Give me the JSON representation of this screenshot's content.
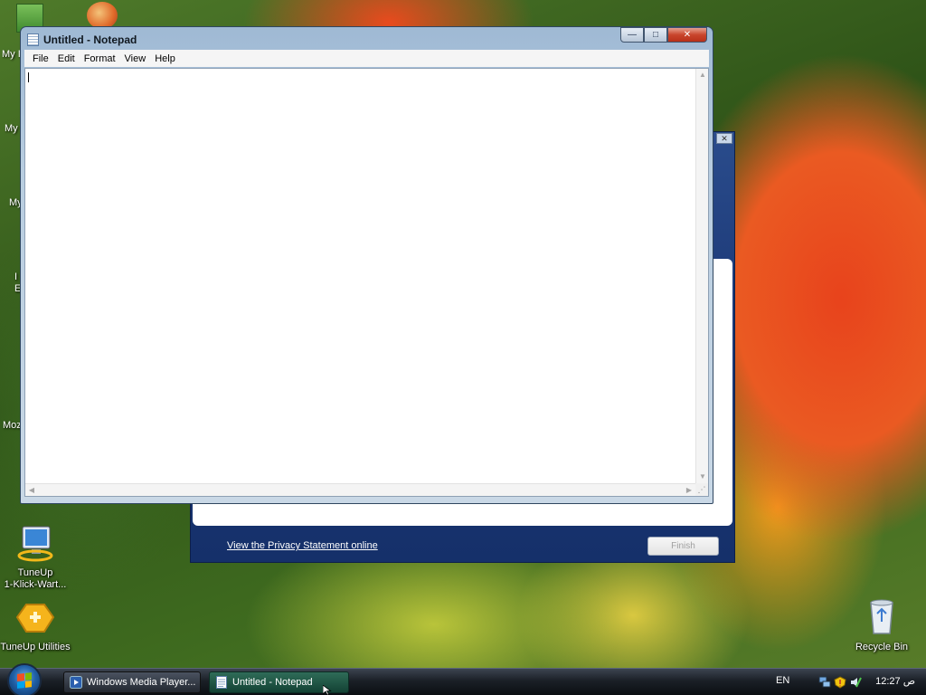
{
  "desktop": {
    "partial_labels": [
      "My I",
      "My",
      "My",
      "I",
      "E",
      "Moz"
    ],
    "icons": [
      {
        "label_line1": "TuneUp",
        "label_line2": "1-Klick-Wart...",
        "icon": "computer-maintenance-icon"
      },
      {
        "label": "TuneUp Utilities",
        "icon": "tuneup-utilities-icon"
      },
      {
        "label": "Recycle Bin",
        "icon": "recycle-bin-icon"
      }
    ]
  },
  "notepad": {
    "title": "Untitled - Notepad",
    "menu": [
      "File",
      "Edit",
      "Format",
      "View",
      "Help"
    ],
    "content": "",
    "caption_buttons": {
      "minimize": "—",
      "maximize": "□",
      "close": "✕"
    }
  },
  "wizard": {
    "privacy_link": "View the Privacy Statement online",
    "finish_label": "Finish"
  },
  "taskbar": {
    "buttons": [
      {
        "label": "Windows Media Player...",
        "active": false,
        "icon": "media-player-icon"
      },
      {
        "label": "Untitled - Notepad",
        "active": true,
        "icon": "notepad-icon"
      }
    ],
    "language": "EN",
    "clock": "12:27 ص"
  },
  "colors": {
    "taskbar_active": "#2f6c58",
    "close_button": "#c9452c",
    "wizard_blue": "#1d3a78"
  }
}
